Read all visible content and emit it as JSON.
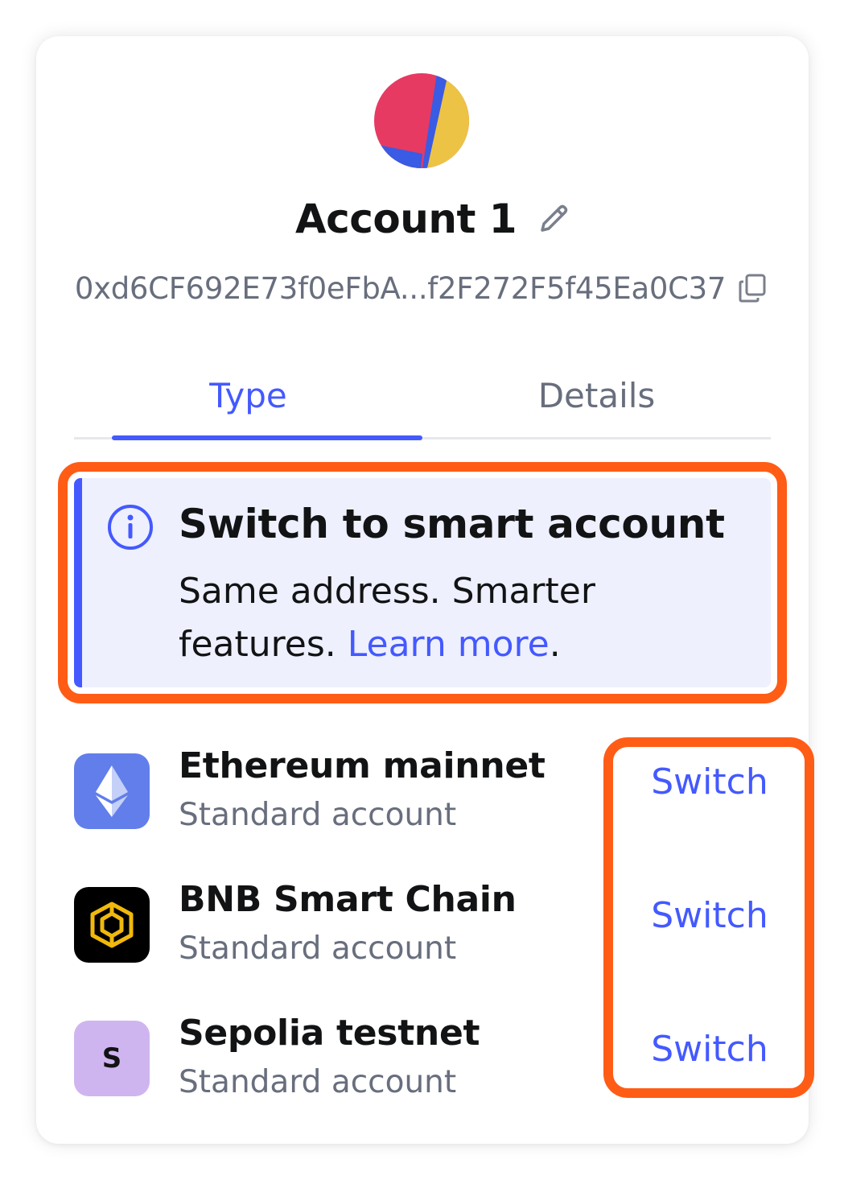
{
  "account": {
    "name": "Account 1",
    "address": "0xd6CF692E73f0eFbA...f2F272F5f45Ea0C37"
  },
  "tabs": [
    {
      "label": "Type",
      "active": true
    },
    {
      "label": "Details",
      "active": false
    }
  ],
  "banner": {
    "title": "Switch to smart account",
    "body": "Same address. Smarter features.",
    "link_label": "Learn more",
    "link_suffix": "."
  },
  "networks": [
    {
      "name": "Ethereum mainnet",
      "account_type": "Standard account",
      "action_label": "Switch",
      "icon": "ethereum-icon"
    },
    {
      "name": "BNB Smart Chain",
      "account_type": "Standard account",
      "action_label": "Switch",
      "icon": "bnb-icon"
    },
    {
      "name": "Sepolia testnet",
      "account_type": "Standard account",
      "action_label": "Switch",
      "icon": "sepolia-icon",
      "icon_letter": "S"
    }
  ],
  "colors": {
    "accent": "#4459ff",
    "highlight": "#ff5c16",
    "banner_bg": "#eef0fe",
    "muted_text": "#686e7d"
  }
}
